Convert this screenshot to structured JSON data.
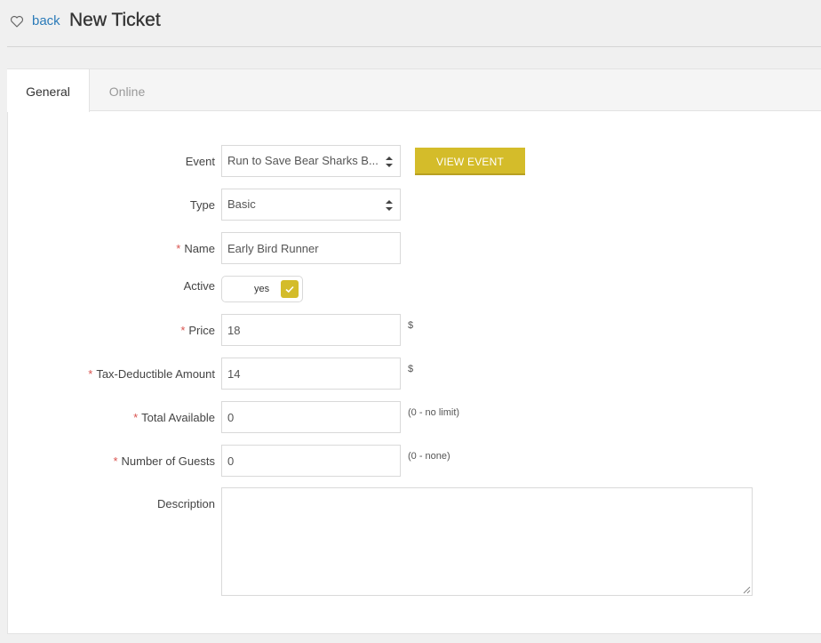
{
  "header": {
    "icon": "heart-icon",
    "back_label": "back",
    "title": "New Ticket"
  },
  "tabs": [
    {
      "label": "General",
      "active": true
    },
    {
      "label": "Online",
      "active": false
    }
  ],
  "form": {
    "event": {
      "label": "Event",
      "value": "Run to Save Bear Sharks B...",
      "button": "VIEW EVENT"
    },
    "type": {
      "label": "Type",
      "value": "Basic"
    },
    "name": {
      "label": "Name",
      "value": "Early Bird Runner",
      "required": true
    },
    "active": {
      "label": "Active",
      "value": "yes"
    },
    "price": {
      "label": "Price",
      "value": "18",
      "suffix": "$",
      "required": true
    },
    "tax": {
      "label": "Tax-Deductible Amount",
      "value": "14",
      "suffix": "$",
      "required": true
    },
    "total": {
      "label": "Total Available",
      "value": "0",
      "hint": "(0 - no limit)",
      "required": true
    },
    "guests": {
      "label": "Number of Guests",
      "value": "0",
      "hint": "(0 - none)",
      "required": true
    },
    "description": {
      "label": "Description",
      "value": ""
    }
  },
  "colors": {
    "accent": "#d4bc2a",
    "link": "#2b7bb9",
    "required": "#d9534f"
  }
}
